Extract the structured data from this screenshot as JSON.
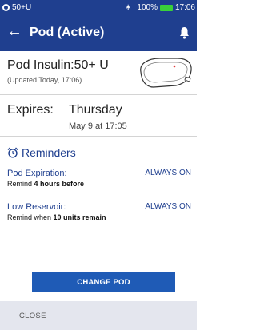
{
  "status_bar": {
    "pod_units": "50+U",
    "battery_percent": "100%",
    "time": "17:06",
    "icons": [
      "pod-status-icon",
      "bluetooth-icon",
      "battery-icon"
    ]
  },
  "header": {
    "title": "Pod (Active)",
    "icons": [
      "back-arrow-icon",
      "bell-icon"
    ]
  },
  "pod": {
    "insulin": "Pod Insulin:50+ U",
    "updated": "(Updated Today, 17:06)"
  },
  "expires": {
    "label": "Expires:",
    "day": "Thursday",
    "date": "May 9 at 17:05"
  },
  "reminders": {
    "title": "Reminders",
    "items": [
      {
        "name": "Pod Expiration:",
        "status": "ALWAYS ON",
        "desc_prefix": "Remind ",
        "desc_bold": "4 hours before",
        "desc_suffix": ""
      },
      {
        "name": "Low Reservoir:",
        "status": "ALWAYS ON",
        "desc_prefix": "Remind when ",
        "desc_bold": "10 units remain",
        "desc_suffix": ""
      }
    ]
  },
  "actions": {
    "change_pod": "CHANGE POD",
    "close": "CLOSE"
  },
  "colors": {
    "primary": "#1f3f8f",
    "button": "#1f5bb6",
    "battery": "#3ad13a",
    "footer_bg": "#e4e6ee"
  }
}
